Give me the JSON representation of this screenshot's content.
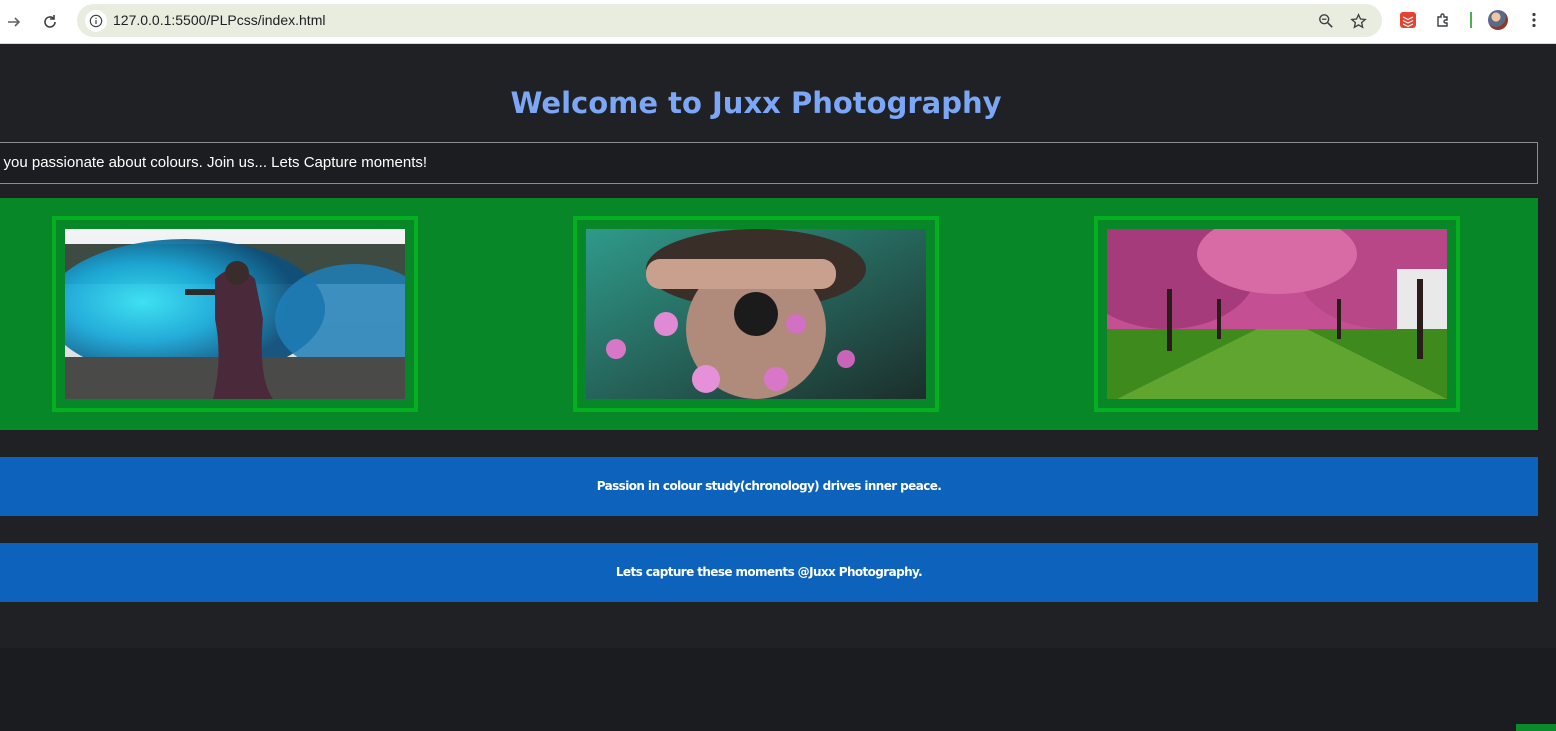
{
  "browser": {
    "url": "127.0.0.1:5500/PLPcss/index.html",
    "back_icon": "arrow-right-icon",
    "reload_icon": "reload-icon",
    "site_info_icon": "info-icon",
    "zoom_icon": "zoom-icon",
    "bookmark_icon": "star-icon",
    "extension_icons": [
      "todoist-icon",
      "puzzle-icon"
    ],
    "menu_icon": "kebab-menu-icon"
  },
  "page": {
    "title": "Welcome to Juxx Photography",
    "marquee_text": "e you passionate about colours. Join us... Lets Capture moments!",
    "gallery": [
      {
        "subject": "blue smoke portrait"
      },
      {
        "subject": "hand over eyes with flowers"
      },
      {
        "subject": "pink cherry blossom trees"
      }
    ],
    "band1_text": "Passion in colour study(chronology) drives inner peace.",
    "band2_text": "Lets capture these moments @Juxx Photography."
  },
  "colors": {
    "title": "#7ca7f7",
    "gallery_bg": "#078728",
    "frame_border": "#03b120",
    "band_bg": "#0d63bc",
    "page_bg": "#1f2125"
  }
}
